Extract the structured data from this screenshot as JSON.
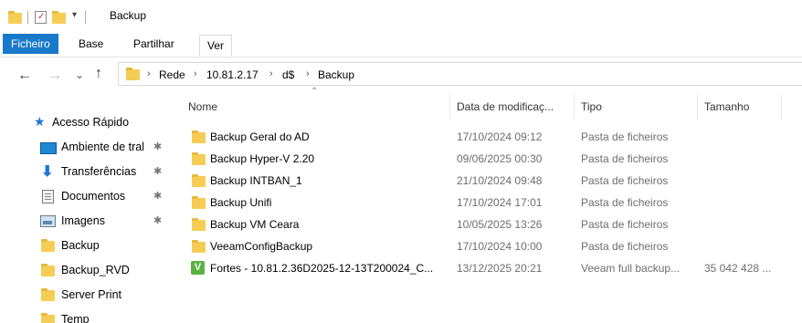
{
  "window": {
    "title": "Backup"
  },
  "ribbon": {
    "tabs": [
      {
        "label": "Ficheiro"
      },
      {
        "label": "Base"
      },
      {
        "label": "Partilhar"
      },
      {
        "label": "Ver"
      }
    ]
  },
  "address": {
    "crumbs": [
      "Rede",
      "10.81.2.17",
      "d$",
      "Backup"
    ]
  },
  "sidebar": {
    "quick_access": "Acesso Rápido",
    "items": [
      {
        "label": "Ambiente de tral",
        "icon": "desktop-icon",
        "pinned": true
      },
      {
        "label": "Transferências",
        "icon": "download-icon",
        "pinned": true
      },
      {
        "label": "Documentos",
        "icon": "documents-icon",
        "pinned": true
      },
      {
        "label": "Imagens",
        "icon": "pictures-icon",
        "pinned": true
      },
      {
        "label": "Backup",
        "icon": "folder-icon",
        "pinned": false
      },
      {
        "label": "Backup_RVD",
        "icon": "folder-icon",
        "pinned": false
      },
      {
        "label": "Server Print",
        "icon": "folder-icon",
        "pinned": false
      },
      {
        "label": "Temp",
        "icon": "folder-icon",
        "pinned": false
      }
    ]
  },
  "columns": {
    "name": "Nome",
    "date": "Data de modificaç...",
    "type": "Tipo",
    "size": "Tamanho"
  },
  "files": [
    {
      "name": "Backup Geral do AD",
      "date": "17/10/2024 09:12",
      "type": "Pasta de ficheiros",
      "size": "",
      "icon": "folder-icon"
    },
    {
      "name": "Backup Hyper-V 2.20",
      "date": "09/06/2025 00:30",
      "type": "Pasta de ficheiros",
      "size": "",
      "icon": "folder-icon"
    },
    {
      "name": "Backup INTBAN_1",
      "date": "21/10/2024 09:48",
      "type": "Pasta de ficheiros",
      "size": "",
      "icon": "folder-icon"
    },
    {
      "name": "Backup Unifi",
      "date": "17/10/2024 17:01",
      "type": "Pasta de ficheiros",
      "size": "",
      "icon": "folder-icon"
    },
    {
      "name": "Backup VM Ceara",
      "date": "10/05/2025 13:26",
      "type": "Pasta de ficheiros",
      "size": "",
      "icon": "folder-icon"
    },
    {
      "name": "VeeamConfigBackup",
      "date": "17/10/2024 10:00",
      "type": "Pasta de ficheiros",
      "size": "",
      "icon": "folder-icon"
    },
    {
      "name": "Fortes - 10.81.2.36D2025-12-13T200024_C...",
      "date": "13/12/2025 20:21",
      "type": "Veeam full backup...",
      "size": "35 042 428 ...",
      "icon": "veeam-backup-icon"
    }
  ],
  "colors": {
    "accent": "#1979ca",
    "folder": "#f6cd54",
    "veeam": "#5bb143"
  }
}
